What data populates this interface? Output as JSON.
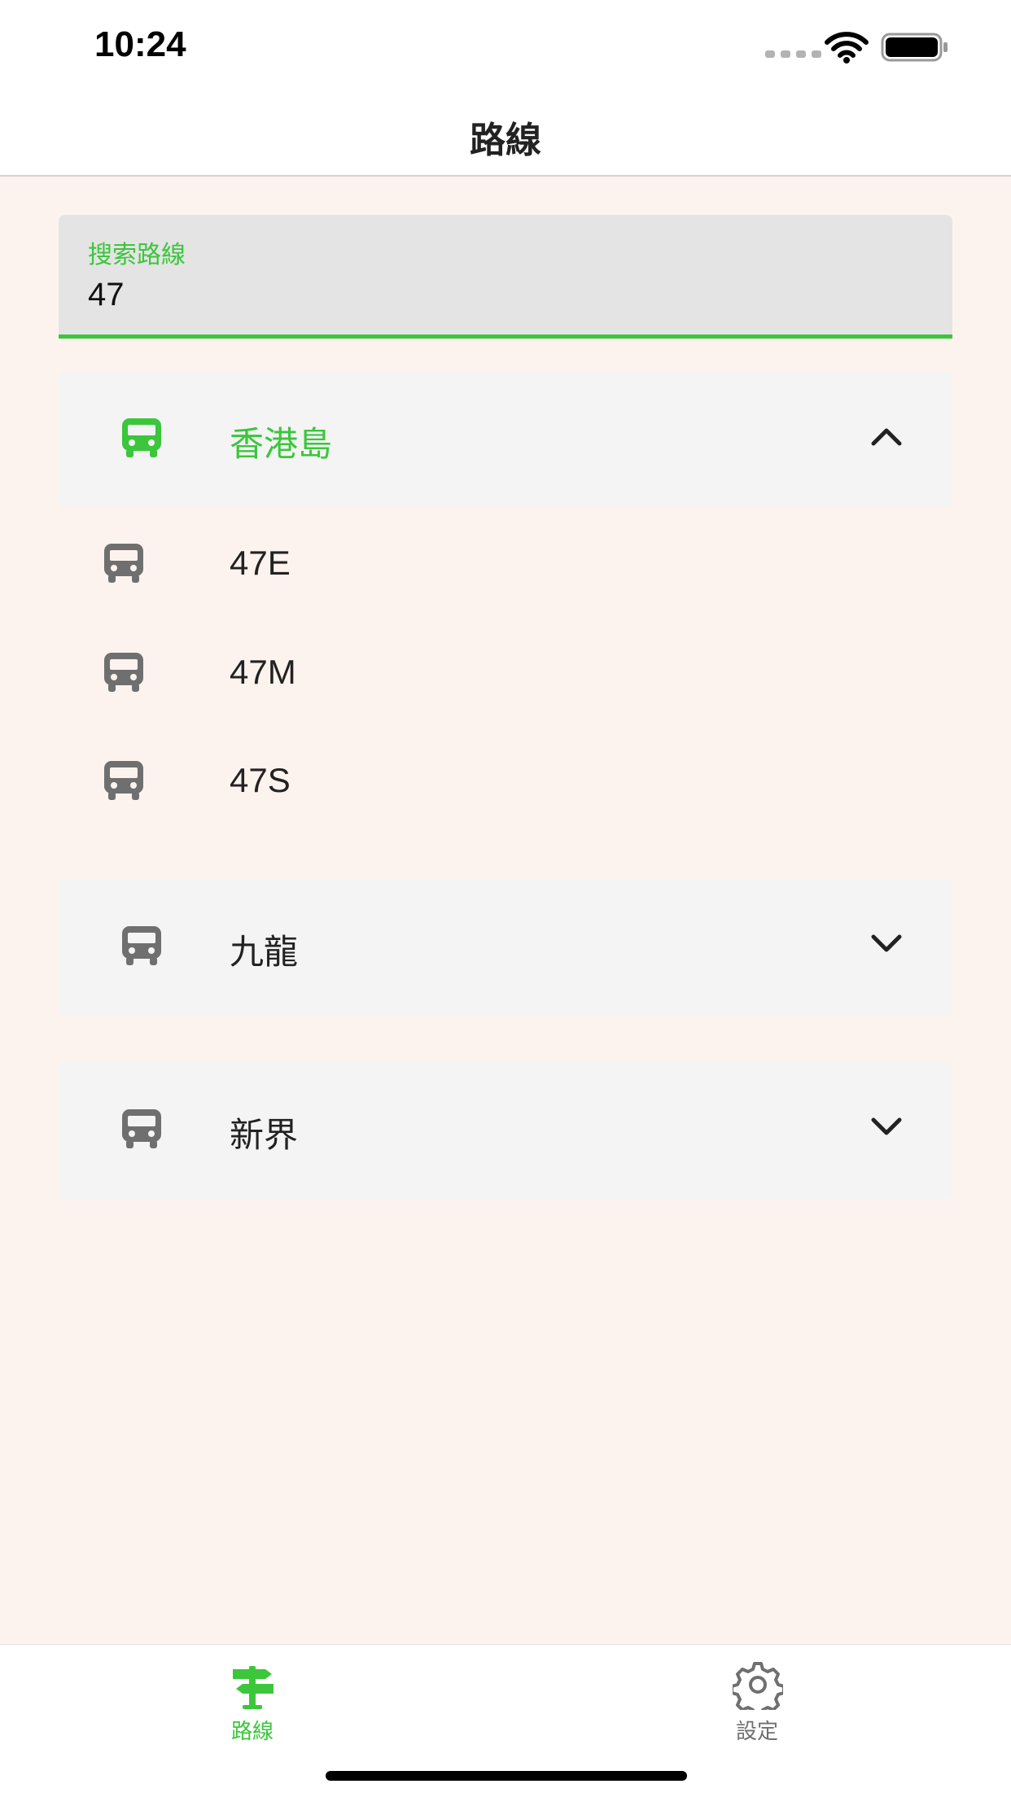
{
  "status_bar": {
    "time": "10:24"
  },
  "nav": {
    "title": "路線"
  },
  "search": {
    "label": "搜索路線",
    "value": "47"
  },
  "colors": {
    "accent": "#3bc63b",
    "icon_gray": "#6f6f6f",
    "background": "#fdf3ee"
  },
  "regions": [
    {
      "label": "香港島",
      "icon": "bus-icon",
      "expanded": true,
      "routes": [
        {
          "label": "47E",
          "icon": "bus-icon"
        },
        {
          "label": "47M",
          "icon": "bus-icon"
        },
        {
          "label": "47S",
          "icon": "bus-icon"
        }
      ]
    },
    {
      "label": "九龍",
      "icon": "bus-icon",
      "expanded": false
    },
    {
      "label": "新界",
      "icon": "bus-icon",
      "expanded": false
    }
  ],
  "tabs": [
    {
      "label": "路線",
      "icon": "signpost-icon",
      "active": true
    },
    {
      "label": "設定",
      "icon": "gear-icon",
      "active": false
    }
  ]
}
